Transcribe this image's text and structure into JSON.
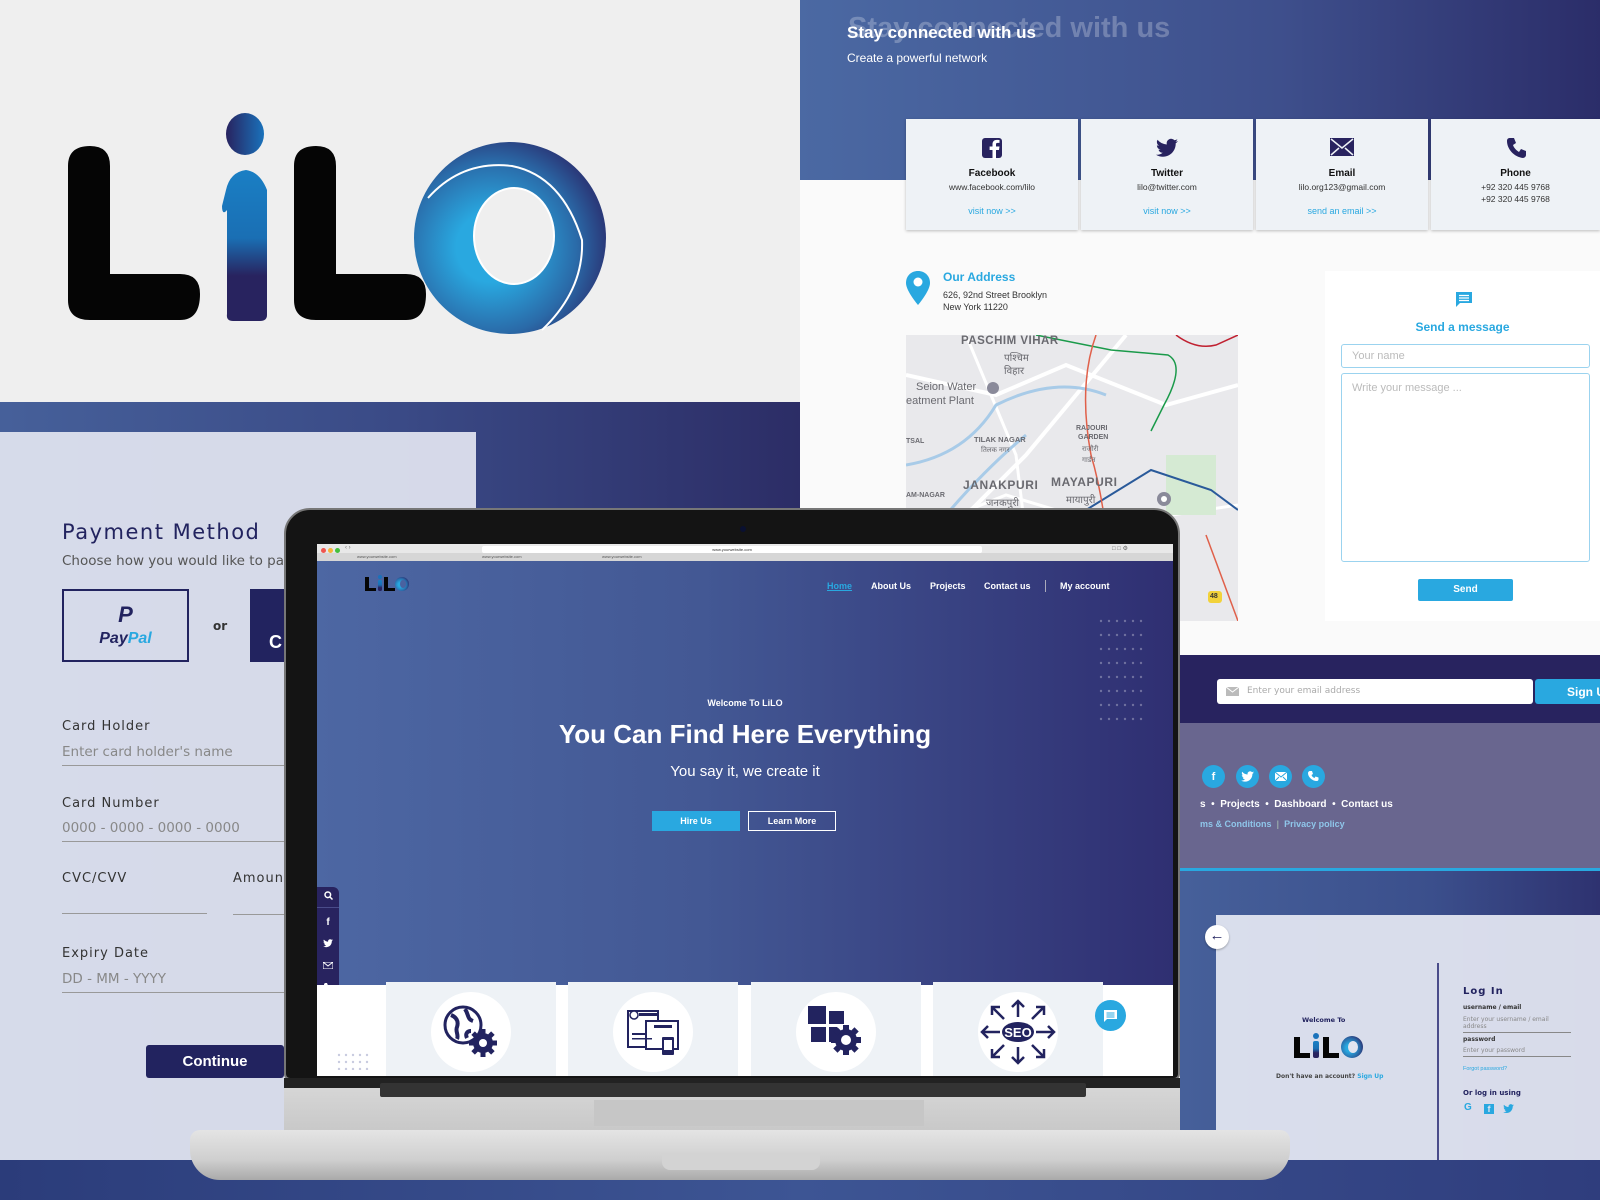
{
  "brand": {
    "name": "LiLO",
    "primary_color": "#22235f",
    "accent_color": "#29a8e0"
  },
  "payment": {
    "title": "Payment Method",
    "subtitle": "Choose how you would like to pay",
    "paypal_label_pay": "Pay",
    "paypal_label_pal": "Pal",
    "or_label": "or",
    "card_button_label": "C",
    "fields": [
      {
        "label": "Card Holder",
        "placeholder": "Enter card holder's name"
      },
      {
        "label": "Card Number",
        "placeholder": "0000 - 0000 - 0000 - 0000"
      },
      {
        "label": "CVC/CVV",
        "placeholder": ""
      },
      {
        "label": "Amount",
        "placeholder": ""
      },
      {
        "label": "Expiry Date",
        "placeholder": "DD - MM - YYYY"
      }
    ],
    "continue_label": "Continue"
  },
  "contact": {
    "title": "Stay connected with us",
    "title_ghost": "Stay connected with us",
    "subtitle": "Create a powerful network",
    "cards": [
      {
        "icon": "facebook-icon",
        "title": "Facebook",
        "value": "www.facebook.com/lilo",
        "value2": "",
        "link": "visit now >>"
      },
      {
        "icon": "twitter-icon",
        "title": "Twitter",
        "value": "lilo@twitter.com",
        "value2": "",
        "link": "visit now >>"
      },
      {
        "icon": "email-icon",
        "title": "Email",
        "value": "lilo.org123@gmail.com",
        "value2": "",
        "link": "send an email >>"
      },
      {
        "icon": "phone-icon",
        "title": "Phone",
        "value": "+92 320 445 9768",
        "value2": "+92 320 445 9768",
        "link": ""
      }
    ],
    "address_title": "Our Address",
    "address_line1": "626, 92nd Street Brooklyn",
    "address_line2": "New York 11220",
    "map_labels": [
      "PASCHIM VIHAR",
      "पश्चिम",
      "विहार",
      "Seion Water",
      "eatment Plant",
      "TILAK NAGAR",
      "तिलक नगर",
      "RAJOURI",
      "GARDEN",
      "राजौरी",
      "गार्डन",
      "JANAKPURI",
      "जनकपुरी",
      "MAYAPURI",
      "मायापुरी",
      "TSAL",
      "AM-NAGAR",
      "48"
    ],
    "message": {
      "title": "Send a message",
      "name_placeholder": "Your name",
      "message_placeholder": "Write your message ...",
      "send_label": "Send"
    }
  },
  "footer": {
    "email_placeholder": "Enter your email address",
    "signup_label": "Sign Up",
    "social": [
      "f",
      "t",
      "@",
      "p"
    ],
    "links": [
      "s",
      "Projects",
      "Dashboard",
      "Contact us"
    ],
    "legal": [
      "ms & Conditions",
      "Privacy policy"
    ]
  },
  "login": {
    "back_icon": "arrow-left-icon",
    "welcome": "Welcome To",
    "logo": "LiLO",
    "no_account": "Don't have an account?",
    "signup_link": "Sign Up",
    "title": "Log In",
    "username_label": "username / email",
    "username_placeholder": "Enter your username / email address",
    "password_label": "password",
    "password_placeholder": "Enter your password",
    "forgot": "Forgot password?",
    "or_login": "Or log in using",
    "social": [
      "G",
      "f",
      "t"
    ]
  },
  "laptop_site": {
    "url": "www.yourwebsite.com",
    "tabs": [
      "www.yourwebsite.com",
      "www.yourwebsite.com",
      "www.yourwebsite.com"
    ],
    "logo": "LiLO",
    "nav": [
      {
        "label": "Home",
        "active": true
      },
      {
        "label": "About Us",
        "active": false
      },
      {
        "label": "Projects",
        "active": false
      },
      {
        "label": "Contact us",
        "active": false
      },
      {
        "label": "My account",
        "active": false
      }
    ],
    "welcome": "Welcome To LiLO",
    "headline": "You Can Find Here Everything",
    "tagline": "You say it, we create it",
    "hire_label": "Hire Us",
    "learn_label": "Learn More",
    "sidebar_icons": [
      "search-icon",
      "facebook-icon",
      "twitter-icon",
      "email-icon",
      "phone-icon"
    ],
    "services": [
      {
        "icon": "web-development-icon"
      },
      {
        "icon": "web-design-icon"
      },
      {
        "icon": "app-settings-icon"
      },
      {
        "icon": "seo-icon",
        "label": "SEO"
      }
    ]
  }
}
